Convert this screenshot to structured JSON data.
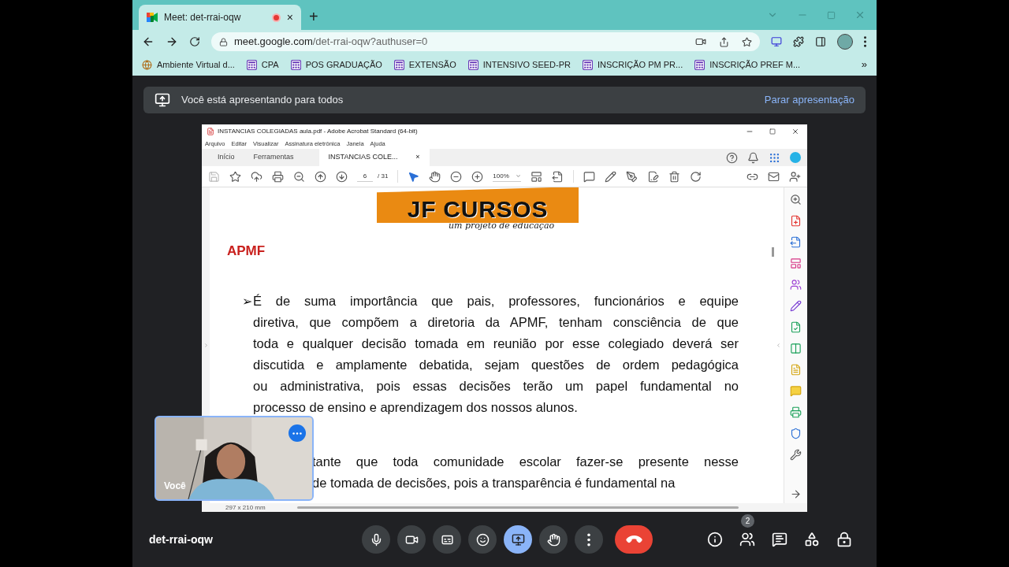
{
  "browser": {
    "tab": {
      "title": "Meet: det-rrai-oqw",
      "recording": true,
      "close": "×"
    },
    "new_tab": "+",
    "url_host": "meet.google.com",
    "url_path": "/det-rrai-oqw?authuser=0",
    "bookmarks": [
      {
        "label": "Ambiente Virtual d...",
        "kind": "site"
      },
      {
        "label": "CPA",
        "kind": "form"
      },
      {
        "label": "POS GRADUAÇÃO",
        "kind": "form"
      },
      {
        "label": "EXTENSÃO",
        "kind": "form"
      },
      {
        "label": "INTENSIVO SEED-PR",
        "kind": "form"
      },
      {
        "label": "INSCRIÇÃO PM PR...",
        "kind": "form"
      },
      {
        "label": "INSCRIÇÃO PREF M...",
        "kind": "form"
      }
    ],
    "more": "»"
  },
  "presenting_bar": {
    "message": "Você está apresentando para todos",
    "action": "Parar apresentação"
  },
  "acrobat": {
    "title": "INSTANCIAS COLEGIADAS aula.pdf - Adobe Acrobat Standard (64-bit)",
    "menu": [
      "Arquivo",
      "Editar",
      "Visualizar",
      "Assinatura eletrônica",
      "Janela",
      "Ajuda"
    ],
    "tabs": [
      {
        "label": "Início",
        "selected": false
      },
      {
        "label": "Ferramentas",
        "selected": false
      },
      {
        "label": "INSTANCIAS COLE...",
        "selected": true,
        "close": "×"
      }
    ],
    "page": "6",
    "page_count": "/ 31",
    "zoom": "100%",
    "document": {
      "logo_title": "JF CURSOS",
      "logo_subtitle": "um projeto de educação",
      "heading": "APMF",
      "paragraphs": [
        {
          "bullet": "➢",
          "lines": [
            {
              "text": "É de suma importância que pais, professores, funcionários e equipe",
              "covered": false
            },
            {
              "text": "diretiva, que compõem a diretoria da APMF, tenham consciência de que",
              "covered": false
            },
            {
              "text": "toda e qualquer decisão tomada em reunião por esse colegiado deverá ser",
              "covered": false
            },
            {
              "text": "discutida e amplamente debatida, sejam questões de ordem pedagógica",
              "covered": false
            },
            {
              "text": "ou administrativa, pois essas decisões terão um papel fundamental no",
              "covered": false
            },
            {
              "text": "processo de ensino e aprendizagem dos nossos alunos.",
              "covered": false
            }
          ]
        },
        {
          "lines": [
            {
              "text": "tante que toda comunidade escolar fazer-se presente nesse",
              "covered": true
            },
            {
              "text": "de tomada de decisões, pois a transparência é fundamental na",
              "covered": true
            }
          ]
        }
      ]
    },
    "page_size": "297 x 210 mm"
  },
  "self_view": {
    "name": "Você"
  },
  "meeting": {
    "code": "det-rrai-oqw",
    "controls": [
      {
        "kind": "mic",
        "selected": false
      },
      {
        "kind": "camera",
        "selected": false
      },
      {
        "kind": "captions",
        "selected": false
      },
      {
        "kind": "emoji",
        "selected": false
      },
      {
        "kind": "present",
        "selected": true
      },
      {
        "kind": "hand",
        "selected": false
      },
      {
        "kind": "more",
        "selected": false
      },
      {
        "kind": "hangup",
        "selected": false
      }
    ],
    "side": [
      {
        "kind": "info"
      },
      {
        "kind": "people",
        "badge": "2"
      },
      {
        "kind": "chat"
      },
      {
        "kind": "activities"
      },
      {
        "kind": "lock"
      }
    ]
  }
}
